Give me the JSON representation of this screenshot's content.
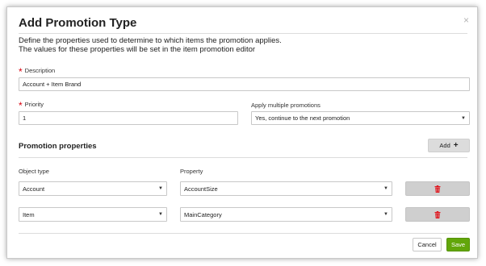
{
  "dialog": {
    "title": "Add Promotion Type",
    "close_glyph": "×",
    "description_line1": "Define the properties used to determine to which items the promotion applies.",
    "description_line2": "The values for these properties will be set in the item promotion editor"
  },
  "form": {
    "required_marker": "*",
    "description_label": "Description",
    "description_value": "Account + Item Brand",
    "priority_label": "Priority",
    "priority_value": "1",
    "apply_multiple_label": "Apply multiple promotions",
    "apply_multiple_value": "Yes, continue to the next promotion"
  },
  "promotion_properties": {
    "title": "Promotion properties",
    "add_label": "Add",
    "add_icon": "+",
    "object_type_header": "Object type",
    "property_header": "Property",
    "rows": [
      {
        "object_type": "Account",
        "property": "AccountSize"
      },
      {
        "object_type": "Item",
        "property": "MainCategory"
      }
    ]
  },
  "footer": {
    "cancel_label": "Cancel",
    "save_label": "Save"
  },
  "colors": {
    "required": "#d9000d",
    "save": "#62a60a",
    "delete_icon": "#e0161e"
  },
  "icons": {
    "delete": "trash-icon",
    "caret": "chevron-down-icon",
    "close": "close-icon",
    "add": "plus-icon"
  }
}
